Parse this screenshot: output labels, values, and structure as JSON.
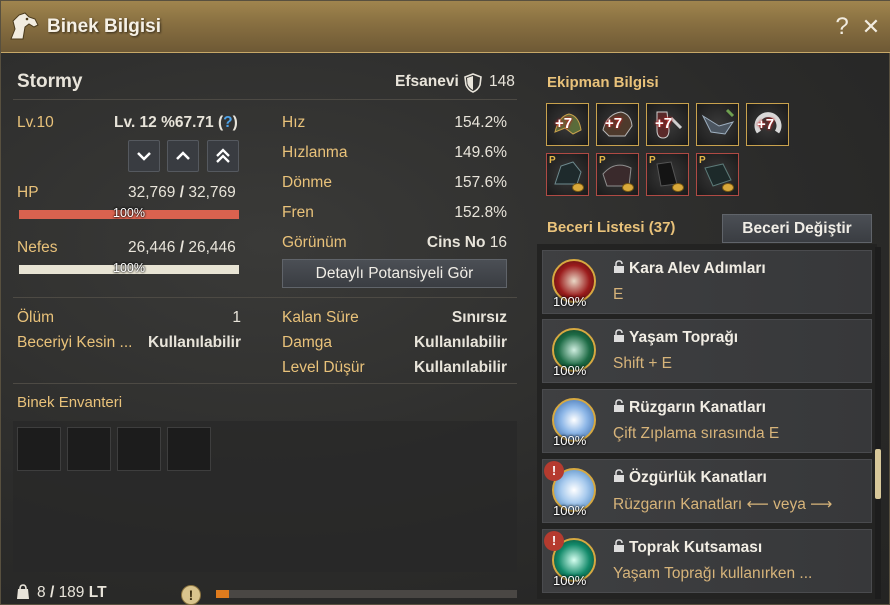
{
  "window": {
    "title": "Binek Bilgisi",
    "help_label": "?",
    "close_label": "✕"
  },
  "mount": {
    "name": "Stormy",
    "grade": "Efsanevi",
    "gear_score": "148",
    "level_label": "Lv.10",
    "next_level_label": "Lv. 12 %67.71 (",
    "next_level_help": "?",
    "next_level_close": ")",
    "hp_label": "HP",
    "hp_current": "32,769",
    "hp_max": "32,769",
    "hp_percent": "100%",
    "hp_fill": 1.0,
    "stamina_label": "Nefes",
    "stamina_current": "26,446",
    "stamina_max": "26,446",
    "stamina_percent": "100%",
    "stamina_fill": 1.0,
    "separator": "/"
  },
  "stats": [
    {
      "label": "Hız",
      "value": "154.2%"
    },
    {
      "label": "Hızlanma",
      "value": "149.6%"
    },
    {
      "label": "Dönme",
      "value": "157.6%"
    },
    {
      "label": "Fren",
      "value": "152.8%"
    },
    {
      "label": "Görünüm",
      "value": "16",
      "prefix": "Cins No"
    }
  ],
  "potential_button": "Detaylı Potansiyeli Gör",
  "status_left": [
    {
      "label": "Ölüm",
      "value": "1"
    },
    {
      "label": "Beceriyi Kesin ...",
      "value": "Kullanılabilir"
    }
  ],
  "status_right": [
    {
      "label": "Kalan Süre",
      "value": "Sınırsız"
    },
    {
      "label": "Damga",
      "value": "Kullanılabilir"
    },
    {
      "label": "Level Düşür",
      "value": "Kullanılabilir"
    }
  ],
  "inventory": {
    "title": "Binek Envanteri",
    "weight_current": "8",
    "weight_max": "189",
    "weight_unit": "LT",
    "weight_fill": 0.042,
    "warn_label": "!"
  },
  "equipment": {
    "title": "Ekipman Bilgisi",
    "enhanced_label": "+7",
    "p_label": "P"
  },
  "skills": {
    "title": "Beceri Listesi",
    "count": "(37)",
    "change_button": "Beceri Değiştir",
    "items": [
      {
        "name": "Kara Alev Adımları",
        "key": "E",
        "percent": "100%",
        "warn": false,
        "color": "#9b1c1c"
      },
      {
        "name": "Yaşam Toprağı",
        "key": "Shift + E",
        "percent": "100%",
        "warn": false,
        "color": "#1d6b45"
      },
      {
        "name": "Rüzgarın Kanatları",
        "key": "Çift Zıplama sırasında E",
        "percent": "100%",
        "warn": false,
        "color": "#2d5fa0"
      },
      {
        "name": "Özgürlük Kanatları",
        "key": "Rüzgarın Kanatları ⟵ veya ⟶",
        "percent": "100%",
        "warn": true,
        "color": "#3b79b8"
      },
      {
        "name": "Toprak Kutsaması",
        "key": "Yaşam Toprağı kullanırken ...",
        "percent": "100%",
        "warn": true,
        "color": "#138a6a"
      }
    ],
    "warn_label": "!"
  },
  "colors": {
    "hp_bar": "#d9624f",
    "stamina_bar": "#e8e4d4",
    "weight_bar": "#e07b1d",
    "accent": "#c9a24d"
  }
}
